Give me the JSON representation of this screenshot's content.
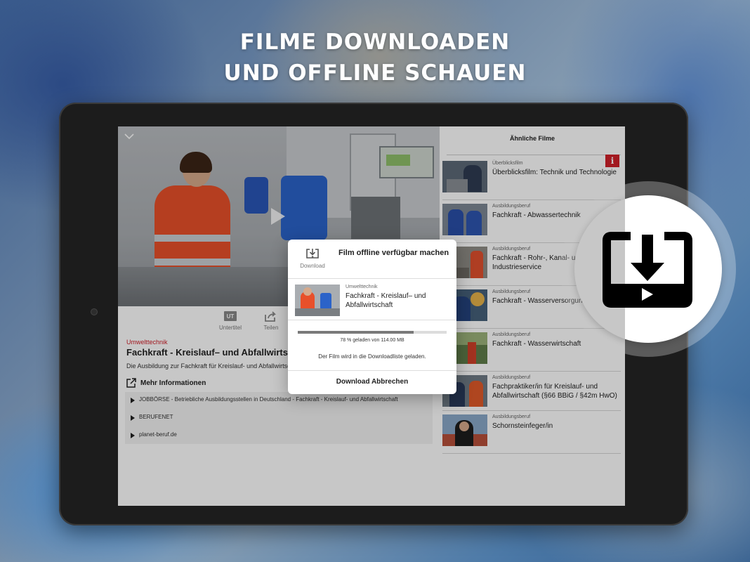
{
  "headline": {
    "line1": "FILME DOWNLOADEN",
    "line2": "UND OFFLINE SCHAUEN"
  },
  "player": {
    "toolbar": {
      "subtitles_label": "Untertitel",
      "share_label": "Teilen"
    }
  },
  "film": {
    "category": "Umwelttechnik",
    "title": "Fachkraft - Kreislauf– und Abfallwirtschaft",
    "description": "Die Ausbildung zur Fachkraft für Kreislauf- und Abfallwirtschaft"
  },
  "more_info": {
    "label": "Mehr Informationen",
    "links": [
      "JOBBÖRSE - Betriebliche Ausbildungsstellen in Deutschland - Fachkraft - Kreislauf- und Abfallwirtschaft",
      "BERUFENET",
      "planet-beruf.de"
    ]
  },
  "similar": {
    "title": "Ähnliche Filme",
    "badge": "i",
    "items": [
      {
        "category": "Überblicksfilm",
        "title": "Überblicksfilm: Technik und Technologie"
      },
      {
        "category": "Ausbildungsberuf",
        "title": "Fachkraft - Abwassertechnik"
      },
      {
        "category": "Ausbildungsberuf",
        "title": "Fachkraft - Rohr-, Kanal- und Industrieservice"
      },
      {
        "category": "Ausbildungsberuf",
        "title": "Fachkraft - Wasserversorgungstechnik"
      },
      {
        "category": "Ausbildungsberuf",
        "title": "Fachkraft - Wasserwirtschaft"
      },
      {
        "category": "Ausbildungsberuf",
        "title": "Fachpraktiker/in für Kreislauf- und Abfallwirtschaft (§66 BBiG / §42m HwO)"
      },
      {
        "category": "Ausbildungsberuf",
        "title": "Schornsteinfeger/in"
      }
    ]
  },
  "modal": {
    "download_label": "Download",
    "title": "Film offline verfügbar machen",
    "film_category": "Umwelttechnik",
    "film_title": "Fachkraft - Kreislauf– und Abfallwirtschaft",
    "progress_fraction": 0.78,
    "progress_text": "78 % geladen von 114.00 MB",
    "status_text": "Der Film wird in die Downloadliste geladen.",
    "cancel_label": "Download Abbrechen"
  },
  "colors": {
    "accent": "#d0202a",
    "text": "#222222"
  }
}
